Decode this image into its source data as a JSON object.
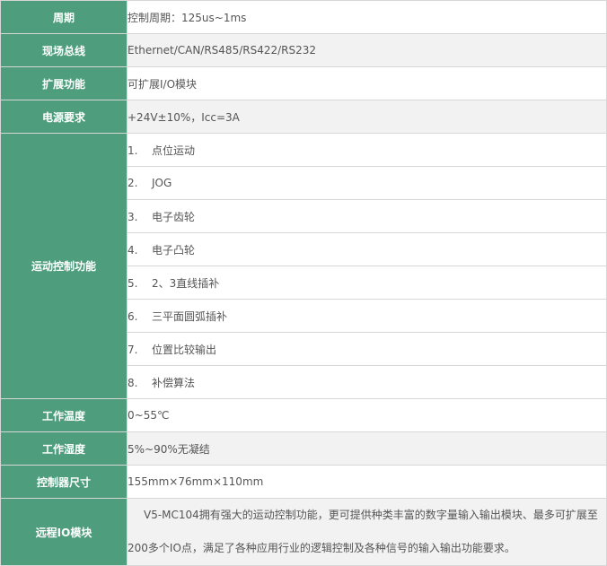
{
  "rows": [
    {
      "label": "周期",
      "value": "控制周期：125us~1ms"
    },
    {
      "label": "现场总线",
      "value": "Ethernet/CAN/RS485/RS422/RS232"
    },
    {
      "label": "扩展功能",
      "value": "可扩展I/O模块"
    },
    {
      "label": "电源要求",
      "value": "+24V±10%，Icc=3A"
    }
  ],
  "motion": {
    "label": "运动控制功能",
    "items": [
      {
        "num": "1.",
        "text": "点位运动"
      },
      {
        "num": "2.",
        "text": "JOG"
      },
      {
        "num": "3.",
        "text": "电子齿轮"
      },
      {
        "num": "4.",
        "text": "电子凸轮"
      },
      {
        "num": "5.",
        "text": "2、3直线插补"
      },
      {
        "num": "6.",
        "text": "三平面圆弧插补"
      },
      {
        "num": "7.",
        "text": "位置比较输出"
      },
      {
        "num": "8.",
        "text": "补偿算法"
      }
    ]
  },
  "rows2": [
    {
      "label": "工作温度",
      "value": "0~55℃"
    },
    {
      "label": "工作湿度",
      "value": "5%~90%无凝结"
    },
    {
      "label": "控制器尺寸",
      "value": "155mm×76mm×110mm"
    }
  ],
  "remote": {
    "label": "远程IO模块",
    "value": "V5-MC104拥有强大的运动控制功能，更可提供种类丰富的数字量输入输出模块、最多可扩展至200多个IO点，满足了各种应用行业的逻辑控制及各种信号的输入输出功能要求。"
  },
  "colors": {
    "label_bg": "#4e9e7d",
    "alt_row_bg": "#f2f2f2",
    "border": "#d7d7d7"
  }
}
